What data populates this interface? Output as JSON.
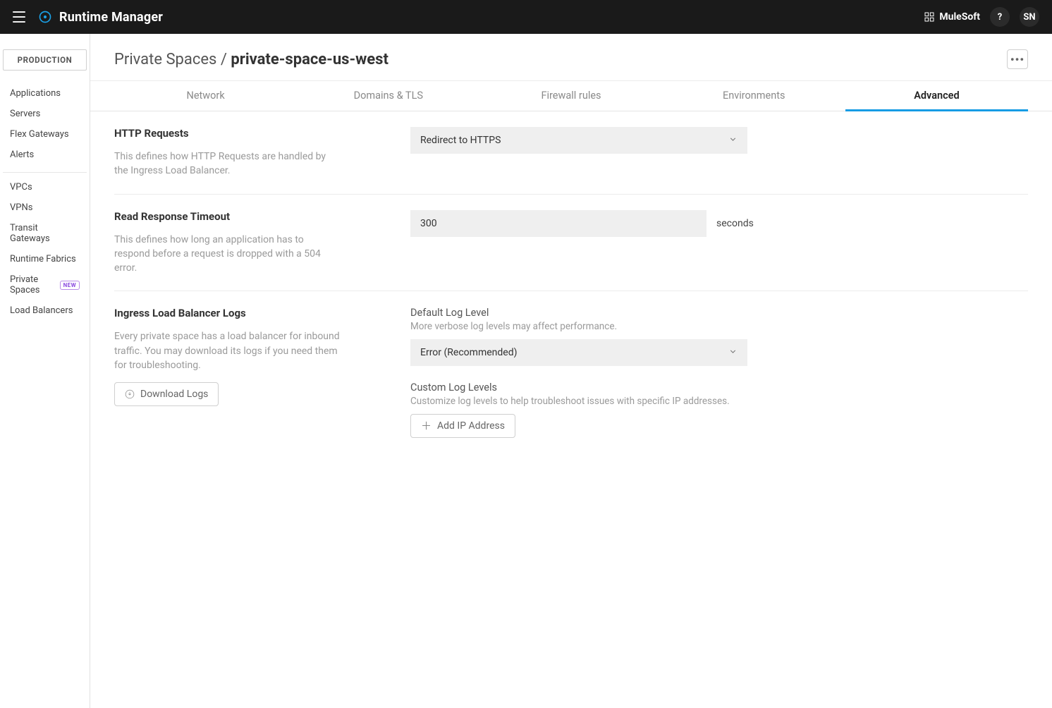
{
  "header": {
    "app_name": "Runtime Manager",
    "brand_link": "MuleSoft",
    "help_label": "?",
    "user_initials": "SN"
  },
  "sidebar": {
    "environment": "PRODUCTION",
    "group1": [
      "Applications",
      "Servers",
      "Flex Gateways",
      "Alerts"
    ],
    "group2": [
      "VPCs",
      "VPNs",
      "Transit Gateways",
      "Runtime Fabrics",
      "Private Spaces",
      "Load Balancers"
    ],
    "new_badge_on": "Private Spaces",
    "new_badge_text": "NEW"
  },
  "breadcrumb": {
    "parent": "Private Spaces",
    "sep": " / ",
    "current": "private-space-us-west"
  },
  "tabs": [
    "Network",
    "Domains & TLS",
    "Firewall rules",
    "Environments",
    "Advanced"
  ],
  "active_tab": "Advanced",
  "sections": {
    "http": {
      "title": "HTTP Requests",
      "desc": "This defines how HTTP Requests are handled by the Ingress Load Balancer.",
      "value": "Redirect to HTTPS"
    },
    "timeout": {
      "title": "Read Response Timeout",
      "desc": "This defines how long an application has to respond before a request is dropped with a 504 error.",
      "value": "300",
      "unit": "seconds"
    },
    "logs": {
      "title": "Ingress Load Balancer Logs",
      "desc": "Every private space has a load balancer for inbound traffic. You may download its logs if you need them for troubleshooting.",
      "download_btn": "Download Logs",
      "default_label": "Default Log Level",
      "default_desc": "More verbose log levels may affect performance.",
      "default_value": "Error (Recommended)",
      "custom_label": "Custom Log Levels",
      "custom_desc": "Customize log levels to help troubleshoot issues with specific IP addresses.",
      "add_ip_btn": "Add IP Address"
    }
  }
}
